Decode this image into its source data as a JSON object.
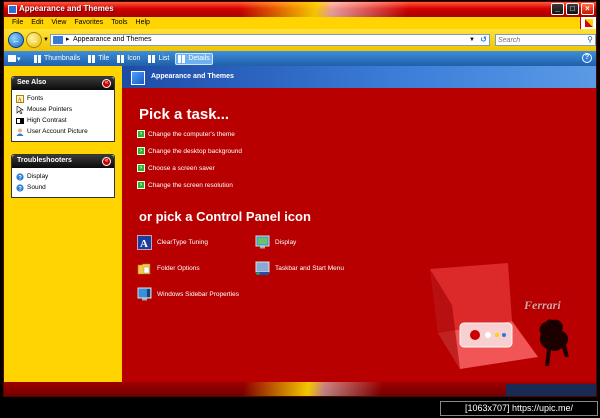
{
  "window": {
    "title": "Appearance and Themes"
  },
  "menu": [
    "File",
    "Edit",
    "View",
    "Favorites",
    "Tools",
    "Help"
  ],
  "address": {
    "path": "Appearance and Themes",
    "search_placeholder": "Search"
  },
  "toolbar": {
    "views": [
      "Thumbnails",
      "Tile",
      "Icon",
      "List",
      "Details"
    ],
    "active_view": "Details"
  },
  "sidebar": {
    "see_also": {
      "title": "See Also",
      "items": [
        "Fonts",
        "Mouse Pointers",
        "High Contrast",
        "User Account Picture"
      ]
    },
    "troubleshooters": {
      "title": "Troubleshooters",
      "items": [
        "Display",
        "Sound"
      ]
    }
  },
  "content": {
    "header": "Appearance and Themes",
    "pick_task": "Pick a task...",
    "tasks": [
      "Change the computer's theme",
      "Change the desktop background",
      "Choose a screen saver",
      "Change the screen resolution"
    ],
    "pick_icon": "or pick a Control Panel icon",
    "icons": [
      "ClearType Tuning",
      "Display",
      "Folder Options",
      "Taskbar and Start Menu",
      "Windows Sidebar Properties"
    ],
    "brand": "Ferrari"
  },
  "badge": "[1063x707] https://upic.me/",
  "colors": {
    "accent_red": "#b80000",
    "accent_yellow": "#ffd400",
    "toolbar_blue": "#2a6fc0"
  }
}
